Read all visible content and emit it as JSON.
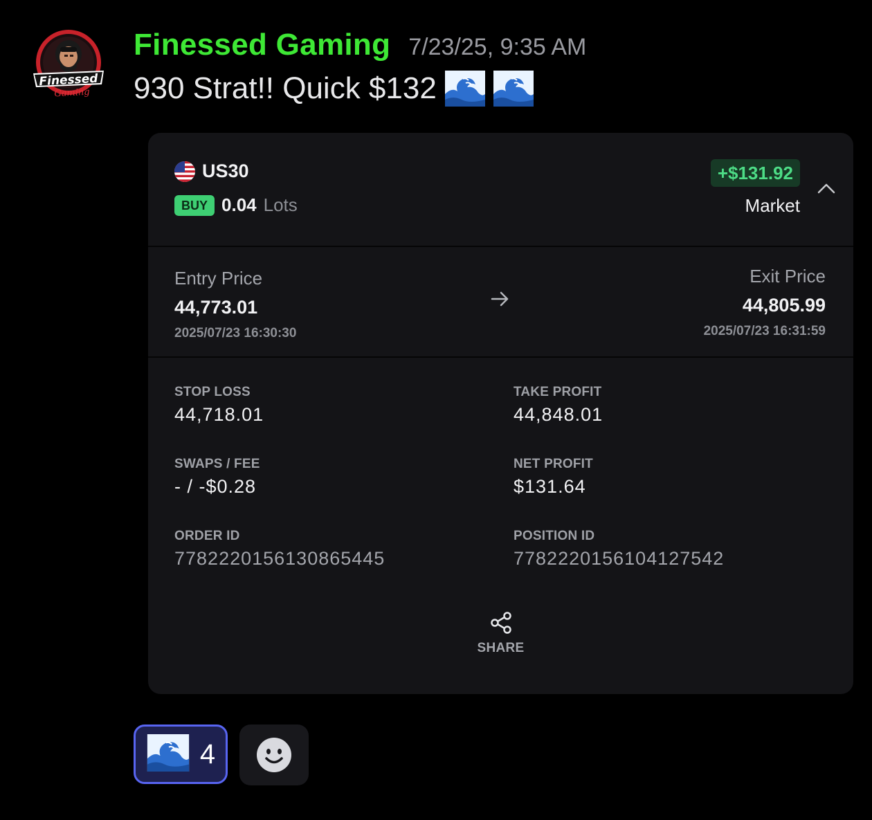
{
  "message": {
    "author": "Finessed Gaming",
    "timestamp": "7/23/25, 9:35 AM",
    "text": "930 Strat!! Quick $132",
    "emoji": "ocean-wave",
    "avatar_text": "Finessed",
    "avatar_subtext": "Gaming"
  },
  "trade": {
    "symbol": "US30",
    "side": "BUY",
    "lots_value": "0.04",
    "lots_label": "Lots",
    "profit": "+$131.92",
    "order_type": "Market",
    "entry_label": "Entry Price",
    "entry_price": "44,773.01",
    "entry_time": "2025/07/23 16:30:30",
    "exit_label": "Exit Price",
    "exit_price": "44,805.99",
    "exit_time": "2025/07/23 16:31:59",
    "details": {
      "stop_loss_label": "STOP LOSS",
      "stop_loss": "44,718.01",
      "take_profit_label": "TAKE PROFIT",
      "take_profit": "44,848.01",
      "swaps_fee_label": "SWAPS / FEE",
      "swaps_fee": "- / -$0.28",
      "net_profit_label": "NET PROFIT",
      "net_profit": "$131.64",
      "order_id_label": "ORDER ID",
      "order_id": "778222015613086 5445",
      "position_id_label": "POSITION ID",
      "position_id": "7782220156104127542"
    },
    "share_label": "SHARE"
  },
  "reactions": {
    "wave_count": "4"
  },
  "colors": {
    "author": "#3ee835",
    "profit": "#4ddc86",
    "buy_badge": "#3ecf73",
    "reaction_border": "#5865f2"
  }
}
